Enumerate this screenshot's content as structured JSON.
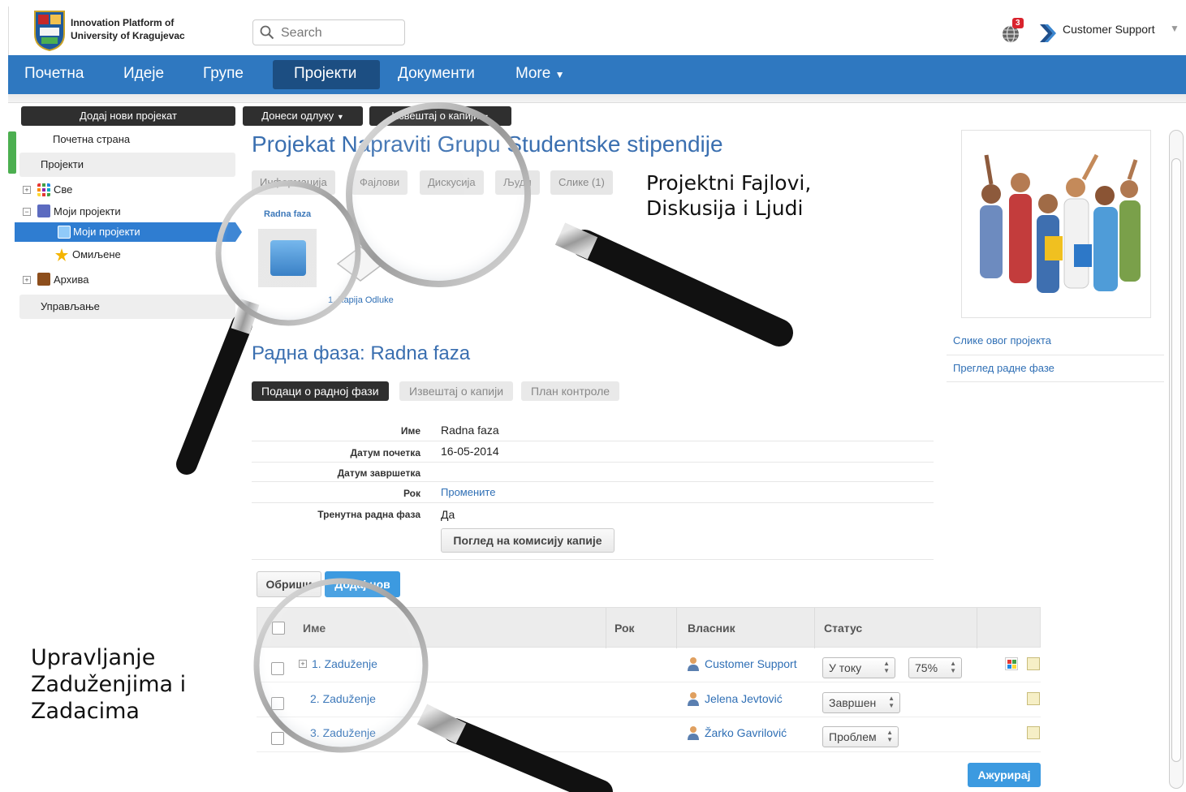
{
  "header": {
    "org_line1": "Innovation Platform of",
    "org_line2": "University of Kragujevac",
    "search_placeholder": "Search",
    "notification_count": "3",
    "user_name": "Customer Support"
  },
  "nav": {
    "items": [
      "Почетна",
      "Идеје",
      "Групе",
      "Пројекти",
      "Документи",
      "More"
    ],
    "active": "Пројекти"
  },
  "toolbar": {
    "add_project": "Додај нови пројекат",
    "make_decision": "Донеси одлуку",
    "gate_report": "Извештај о капији"
  },
  "sidebar": {
    "home": "Почетна страна",
    "projects_section": "Пројекти",
    "all": "Све",
    "my_projects": "Моји пројекти",
    "my_projects_child": "Моји пројекти",
    "favorites": "Омиљене",
    "archive": "Архива",
    "management": "Управљање"
  },
  "project": {
    "title": "Projekat Napraviti Grupu Studentske stipendije",
    "tabs": [
      "Информација",
      "Фајлови",
      "Дискусија",
      "Људи",
      "Слике (1)"
    ],
    "gate_label": "Radna faza",
    "gate_link": "1. Kapija Odluke"
  },
  "callouts": {
    "top_line1": "Projektni Fajlovi,",
    "top_line2": "Diskusija i Ljudi",
    "bottom_line1": "Upravljanje",
    "bottom_line2": "Zaduženjima i",
    "bottom_line3": "Zadacima"
  },
  "phase": {
    "title": "Радна фаза: Radna faza",
    "tabs": [
      "Подаци о радној фази",
      "Извештај о капији",
      "План контроле"
    ],
    "fields": [
      {
        "label": "Име",
        "value": "Radna faza"
      },
      {
        "label": "Датум почетка",
        "value": "16-05-2014"
      },
      {
        "label": "Датум завршетка",
        "value": ""
      },
      {
        "label": "Рок",
        "value": "Промените"
      },
      {
        "label": "Тренутна радна фаза",
        "value": "Да"
      }
    ],
    "committee_button": "Поглед на комисију капије"
  },
  "tasks": {
    "delete_button": "Обриши",
    "add_button": "Додај нов",
    "columns": [
      "Име",
      "Рок",
      "Власник",
      "Статус"
    ],
    "rows": [
      {
        "name": "1. Zaduženje",
        "owner": "Customer Support",
        "status": "У току",
        "progress": "75%"
      },
      {
        "name": "2. Zaduženje",
        "owner": "Jelena Jevtović",
        "status": "Завршен"
      },
      {
        "name": "3. Zaduženje",
        "owner": "Žarko Gavrilović",
        "status": "Проблем"
      }
    ],
    "update_button": "Ажурирај"
  },
  "right_panel": {
    "link1": "Слике овог пројекта",
    "link2": "Преглед радне фазе"
  },
  "colors": {
    "nav_blue": "#2f78c0",
    "nav_active": "#1c4e82",
    "link_blue": "#2f6fb5",
    "accent_blue": "#3c9ae0"
  }
}
